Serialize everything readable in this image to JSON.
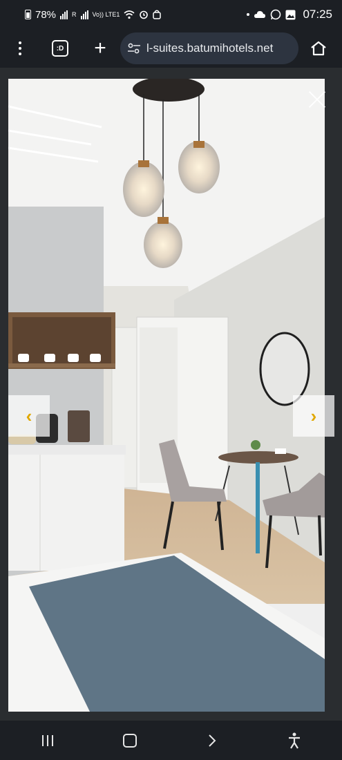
{
  "status_bar": {
    "battery": "78%",
    "network_r1": "R",
    "network_r2": "R",
    "volte": "Vo)) LTE1",
    "time": "07:25"
  },
  "browser": {
    "url": "l-suites.batumihotels.net",
    "tabs_label": ":D"
  },
  "gallery": {
    "prev_arrow": "‹",
    "next_arrow": "›"
  },
  "colors": {
    "arrow_accent": "#e0a800",
    "bed_runner": "#5f7586",
    "table_leg": "#3a8fb0"
  },
  "icons": [
    "battery-icon",
    "signal-icon",
    "wifi-icon",
    "alarm-icon",
    "cloud-icon",
    "whatsapp-icon",
    "gallery-icon",
    "menu-icon",
    "tabs-icon",
    "add-icon",
    "site-settings-icon",
    "home-icon",
    "close-icon",
    "chevron-left-icon",
    "chevron-right-icon",
    "recent-apps-icon",
    "home-nav-icon",
    "back-icon",
    "accessibility-icon"
  ]
}
